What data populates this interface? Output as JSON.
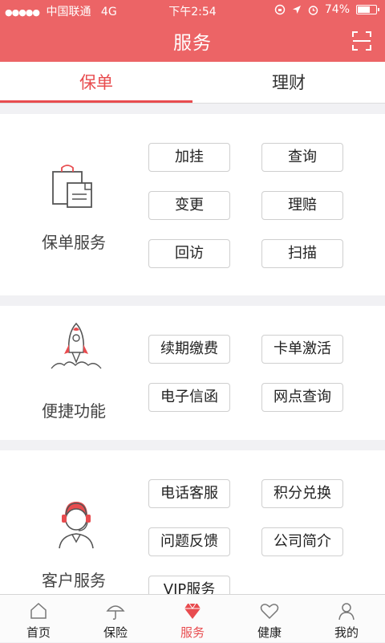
{
  "status_bar": {
    "signal": "●●●●●",
    "carrier": "中国联通",
    "network": "4G",
    "time": "下午2:54",
    "battery_text": "74%",
    "battery_level": 0.74
  },
  "header": {
    "title": "服务"
  },
  "tabs": [
    {
      "label": "保单",
      "active": true
    },
    {
      "label": "理财",
      "active": false
    }
  ],
  "sections": [
    {
      "label": "保单服务",
      "icon": "document-bag-icon",
      "buttons": [
        "加挂",
        "查询",
        "变更",
        "理赔",
        "回访",
        "扫描"
      ]
    },
    {
      "label": "便捷功能",
      "icon": "rocket-icon",
      "buttons": [
        "续期缴费",
        "卡单激活",
        "电子信函",
        "网点查询"
      ]
    },
    {
      "label": "客户服务",
      "icon": "customer-service-icon",
      "buttons": [
        "电话客服",
        "积分兑换",
        "问题反馈",
        "公司简介",
        "VIP服务"
      ]
    }
  ],
  "bottom_nav": [
    {
      "label": "首页",
      "icon": "home-icon"
    },
    {
      "label": "保险",
      "icon": "umbrella-icon"
    },
    {
      "label": "服务",
      "icon": "diamond-icon",
      "active": true
    },
    {
      "label": "健康",
      "icon": "heart-icon"
    },
    {
      "label": "我的",
      "icon": "person-icon"
    }
  ],
  "colors": {
    "accent": "#ec6466",
    "active_text": "#e84c4f"
  }
}
